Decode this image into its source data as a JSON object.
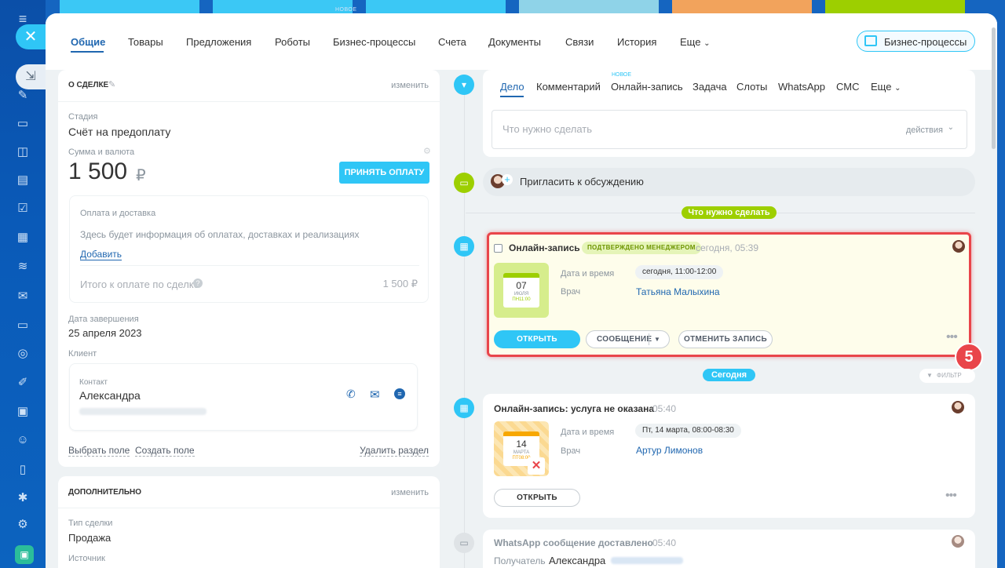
{
  "top": {
    "badge_new": "НОВОЕ"
  },
  "tabs": [
    {
      "label": "Общие"
    },
    {
      "label": "Товары"
    },
    {
      "label": "Предложения"
    },
    {
      "label": "Роботы"
    },
    {
      "label": "Бизнес-процессы"
    },
    {
      "label": "Счета"
    },
    {
      "label": "Документы"
    },
    {
      "label": "Связи"
    },
    {
      "label": "История"
    },
    {
      "label": "Еще"
    }
  ],
  "bp_button": {
    "label": "Бизнес-процессы"
  },
  "deal": {
    "title": "О СДЕЛКЕ",
    "edit": "изменить",
    "stage_label": "Стадия",
    "stage_value": "Счёт на предоплату",
    "sum_label": "Сумма и валюта",
    "sum_value": "1 500",
    "currency": "₽",
    "accept_payment": "ПРИНЯТЬ ОПЛАТУ",
    "payment": {
      "title": "Оплата и доставка",
      "info": "Здесь будет информация об оплатах, доставках и реализациях",
      "add": "Добавить",
      "total_label": "Итого к оплате по сделке",
      "total_value": "1 500 ₽"
    },
    "close_date_label": "Дата завершения",
    "close_date_value": "25 апреля 2023",
    "client_label": "Клиент",
    "contact_label": "Контакт",
    "contact_name": "Александра",
    "select_field": "Выбрать поле",
    "create_field": "Создать поле",
    "delete_section": "Удалить раздел"
  },
  "extra": {
    "title": "ДОПОЛНИТЕЛЬНО",
    "edit": "изменить",
    "type_label": "Тип сделки",
    "type_value": "Продажа",
    "source_label": "Источник"
  },
  "activity_tabs": [
    {
      "label": "Дело"
    },
    {
      "label": "Комментарий"
    },
    {
      "label": "Онлайн-запись",
      "badge": "НОВОЕ"
    },
    {
      "label": "Задача"
    },
    {
      "label": "Слоты"
    },
    {
      "label": "WhatsApp"
    },
    {
      "label": "СМС"
    },
    {
      "label": "Еще"
    }
  ],
  "todo_input": {
    "placeholder": "Что нужно сделать",
    "actions": "действия"
  },
  "invite": "Пригласить к обсуждению",
  "section_todo": "Что нужно сделать",
  "section_today": "Сегодня",
  "filter": "ФИЛЬТР",
  "step_badge": "5",
  "booking1": {
    "title": "Онлайн-запись",
    "status": "ПОДТВЕРЖДЕНО МЕНЕДЖЕРОМ",
    "time": "сегодня, 05:39",
    "cal_day": "07",
    "cal_month": "ИЮЛЯ",
    "cal_sub": "ПН11:00",
    "datetime_label": "Дата и время",
    "datetime_value": "сегодня, 11:00-12:00",
    "doctor_label": "Врач",
    "doctor_value": "Татьяна Малыхина",
    "open": "ОТКРЫТЬ",
    "message": "СООБЩЕНИЕ",
    "cancel": "ОТМЕНИТЬ ЗАПИСЬ"
  },
  "booking2": {
    "title": "Онлайн-запись: услуга не оказана",
    "time": "05:40",
    "cal_day": "14",
    "cal_month": "МАРТА",
    "cal_sub": "ПТ08:00",
    "datetime_label": "Дата и время",
    "datetime_value": "Пт, 14 марта, 08:00-08:30",
    "doctor_label": "Врач",
    "doctor_value": "Артур Лимонов",
    "open": "ОТКРЫТЬ"
  },
  "whatsapp": {
    "title": "WhatsApp сообщение доставлено",
    "time": "05:40",
    "recipient_label": "Получатель",
    "recipient_name": "Александра"
  },
  "colors": {
    "accent": "#2fc6f6",
    "green": "#9dcf00",
    "red": "#e9454a",
    "link": "#2067b0"
  }
}
